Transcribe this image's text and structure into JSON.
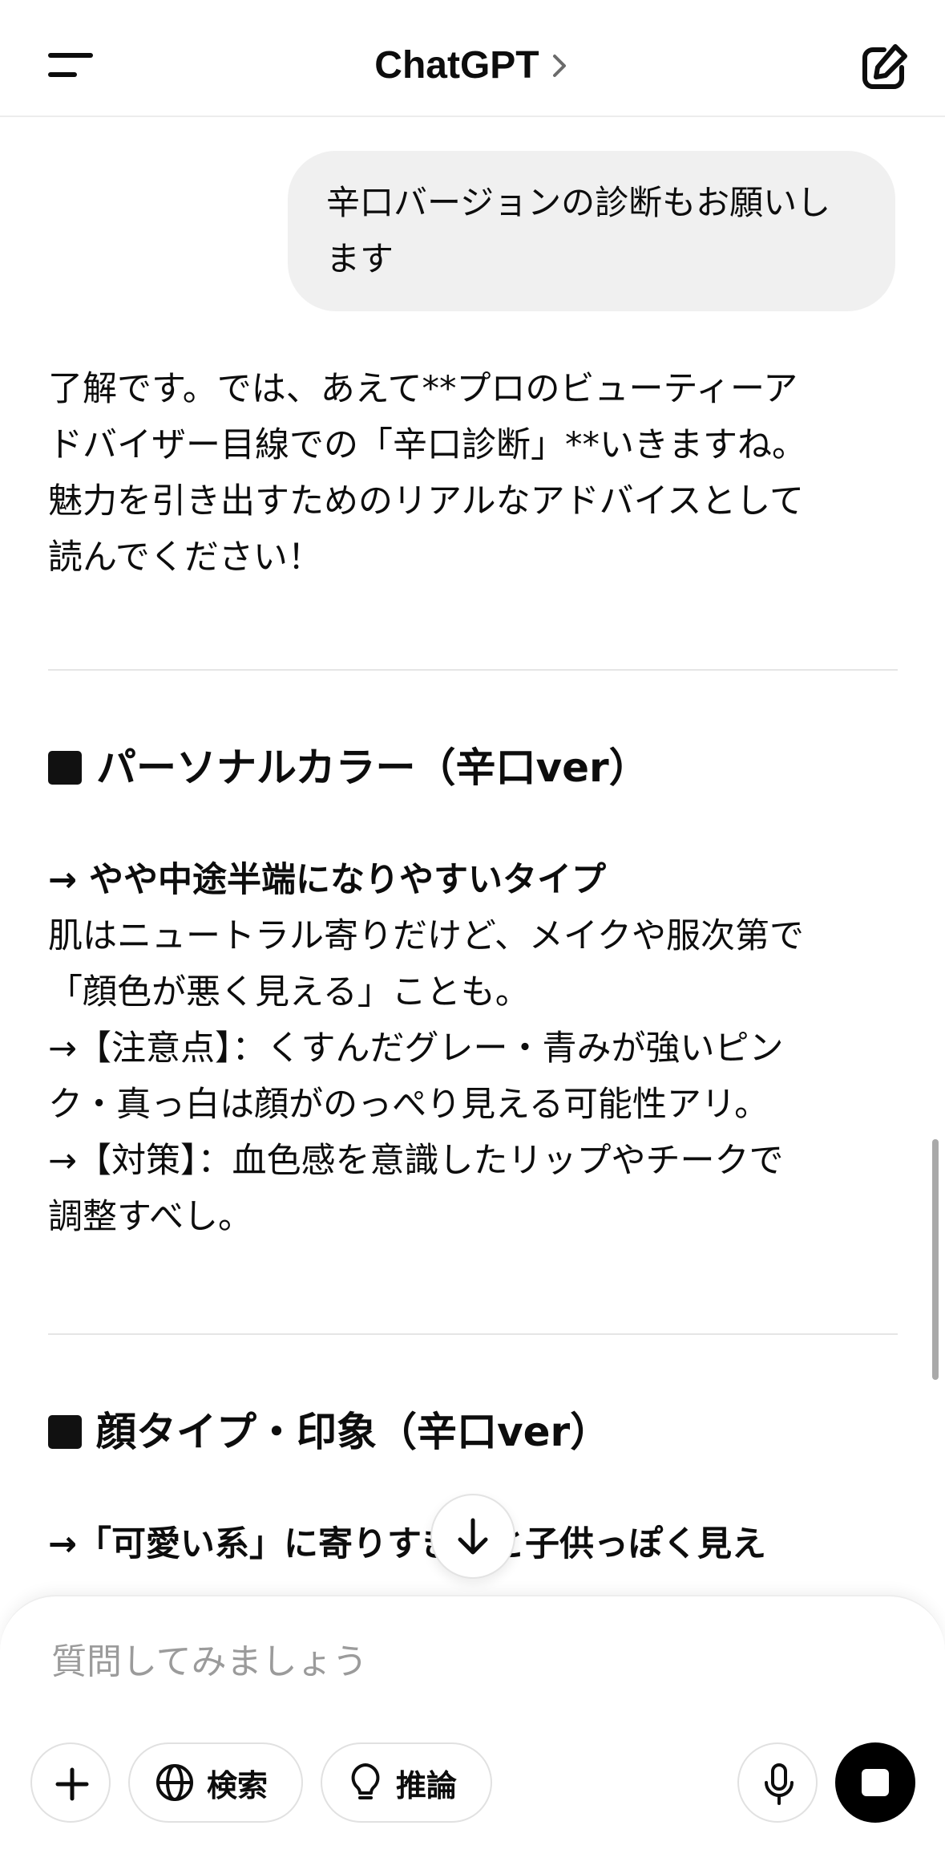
{
  "header": {
    "title": "ChatGPT"
  },
  "conversation": {
    "user_message": "辛口バージョンの診断もお願いします",
    "assistant": {
      "intro_lines": [
        "了解です。では、あえて**プロのビューティーア",
        "ドバイザー目線での「辛口診断」**いきますね。",
        "魅力を引き出すためのリアルなアドバイスとして",
        "読んでください！"
      ],
      "section1": {
        "heading": "パーソナルカラー（辛口ver）",
        "lead": "→ やや中途半端になりやすいタイプ",
        "lines": [
          "肌はニュートラル寄りだけど、メイクや服次第で",
          "「顔色が悪く見える」ことも。",
          "→【注意点】：くすんだグレー・青みが強いピン",
          "ク・真っ白は顔がのっぺり見える可能性アリ。",
          "→【対策】：血色感を意識したリップやチークで",
          "調整すべし。"
        ]
      },
      "section2": {
        "heading": "顔タイプ・印象（辛口ver）",
        "lead": "→「可愛い系」に寄りすぎると子供っぽく見え"
      }
    }
  },
  "composer": {
    "placeholder": "質問してみましょう",
    "search_label": "検索",
    "reason_label": "推論"
  },
  "icons": {
    "menu": "menu-icon",
    "chevron": "chevron-right-icon",
    "compose": "compose-icon",
    "scroll_down": "arrow-down-icon",
    "plus": "plus-icon",
    "globe": "globe-icon",
    "bulb": "lightbulb-icon",
    "mic": "microphone-icon",
    "stop": "stop-icon"
  }
}
